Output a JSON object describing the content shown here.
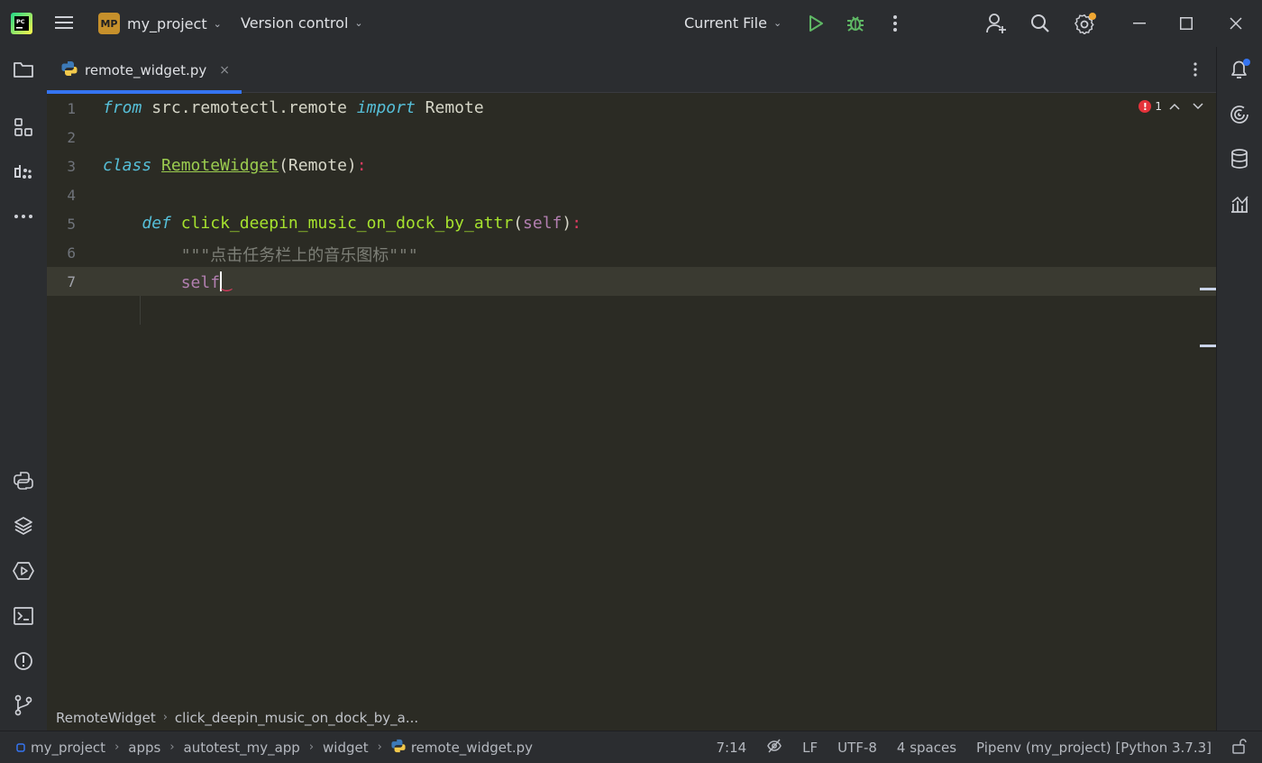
{
  "titlebar": {
    "project_badge": "MP",
    "project_name": "my_project",
    "vcs_label": "Version control",
    "run_config": "Current File"
  },
  "tab": {
    "filename": "remote_widget.py",
    "close": "×"
  },
  "editor": {
    "lines": [
      {
        "number": "1",
        "kw1": "from",
        "mod": " src.remotectl.remote ",
        "kw2": "import",
        "name": " Remote"
      },
      {
        "number": "2"
      },
      {
        "number": "3",
        "kw": "class",
        "sp": " ",
        "cls": "RemoteWidget",
        "base": "(Remote)",
        "colon": ":"
      },
      {
        "number": "4"
      },
      {
        "number": "5",
        "indent": "    ",
        "kw": "def",
        "sp": " ",
        "fn": "click_deepin_music_on_dock_by_attr",
        "po": "(",
        "self": "self",
        "pc": ")",
        "colon": ":"
      },
      {
        "number": "6",
        "indent": "        ",
        "doc": "\"\"\"点击任务栏上的音乐图标\"\"\""
      },
      {
        "number": "7",
        "indent": "        ",
        "self": "self"
      }
    ],
    "error_count": "1",
    "current_line": 7
  },
  "breadcrumbs": {
    "class": "RemoteWidget",
    "method": "click_deepin_music_on_dock_by_a..."
  },
  "statusbar": {
    "path": [
      "my_project",
      "apps",
      "autotest_my_app",
      "widget",
      "remote_widget.py"
    ],
    "position": "7:14",
    "line_ending": "LF",
    "encoding": "UTF-8",
    "indent": "4 spaces",
    "interpreter": "Pipenv (my_project) [Python 3.7.3]"
  },
  "colors": {
    "accent": "#3574f0",
    "error": "#e5333b",
    "run_green": "#5fb865",
    "notification_blue": "#3574f0",
    "settings_badge": "#f0a732"
  },
  "icons": [
    "pycharm-logo",
    "hamburger-menu-icon",
    "run-icon",
    "debug-icon",
    "more-vertical-icon",
    "add-user-icon",
    "search-icon",
    "settings-icon",
    "minimize-icon",
    "maximize-icon",
    "close-icon",
    "folder-icon",
    "structure-icon",
    "plugins-icon",
    "more-horizontal-icon",
    "python-console-icon",
    "layers-icon",
    "services-icon",
    "terminal-icon",
    "problems-icon",
    "git-icon",
    "notifications-icon",
    "ai-assistant-icon",
    "database-icon",
    "sciview-icon",
    "python-file-icon",
    "no-readonly-icon",
    "lock-icon"
  ]
}
